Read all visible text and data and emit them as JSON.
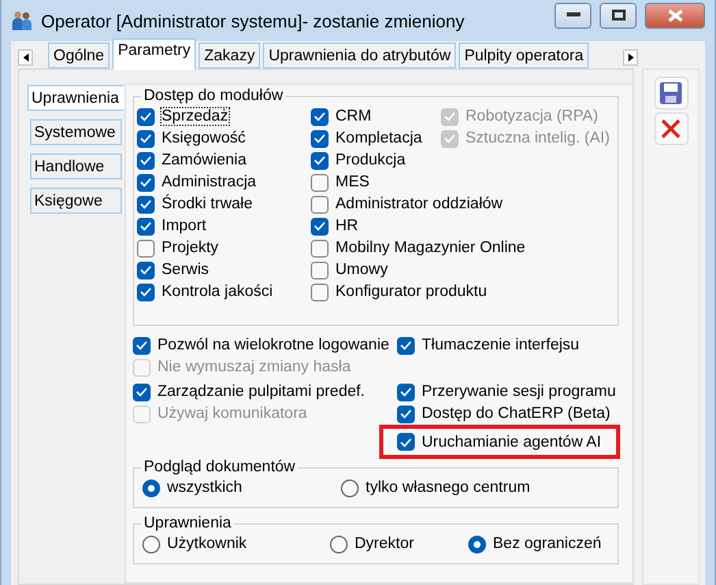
{
  "window": {
    "title": "Operator [Administrator systemu]- zostanie zmieniony"
  },
  "tabs": [
    {
      "label": "Ogólne",
      "selected": false
    },
    {
      "label": "Parametry",
      "selected": true
    },
    {
      "label": "Zakazy",
      "selected": false
    },
    {
      "label": "Uprawnienia do atrybutów",
      "selected": false
    },
    {
      "label": "Pulpity operatora",
      "selected": false
    }
  ],
  "subtabs": [
    {
      "label": "Uprawnienia",
      "selected": true
    },
    {
      "label": "Systemowe",
      "selected": false
    },
    {
      "label": "Handlowe",
      "selected": false
    },
    {
      "label": "Księgowe",
      "selected": false
    }
  ],
  "modules": {
    "title": "Dostęp do modułów",
    "columns": [
      [
        {
          "label": "Sprzedaż",
          "checked": true,
          "disabled": false,
          "focused": true
        },
        {
          "label": "Księgowość",
          "checked": true,
          "disabled": false
        },
        {
          "label": "Zamówienia",
          "checked": true,
          "disabled": false
        },
        {
          "label": "Administracja",
          "checked": true,
          "disabled": false
        },
        {
          "label": "Środki trwałe",
          "checked": true,
          "disabled": false
        },
        {
          "label": "Import",
          "checked": true,
          "disabled": false
        },
        {
          "label": "Projekty",
          "checked": false,
          "disabled": false
        },
        {
          "label": "Serwis",
          "checked": true,
          "disabled": false
        },
        {
          "label": "Kontrola jakości",
          "checked": true,
          "disabled": false
        }
      ],
      [
        {
          "label": "CRM",
          "checked": true,
          "disabled": false
        },
        {
          "label": "Kompletacja",
          "checked": true,
          "disabled": false
        },
        {
          "label": "Produkcja",
          "checked": true,
          "disabled": false
        },
        {
          "label": "MES",
          "checked": false,
          "disabled": false
        },
        {
          "label": "Administrator oddziałów",
          "checked": false,
          "disabled": false
        },
        {
          "label": "HR",
          "checked": true,
          "disabled": false
        },
        {
          "label": "Mobilny Magazynier Online",
          "checked": false,
          "disabled": false
        },
        {
          "label": "Umowy",
          "checked": false,
          "disabled": false
        },
        {
          "label": "Konfigurator produktu",
          "checked": false,
          "disabled": false
        }
      ],
      [
        {
          "label": "Robotyzacja (RPA)",
          "checked": true,
          "disabled": true
        },
        {
          "label": "Sztuczna intelig. (AI)",
          "checked": true,
          "disabled": true
        }
      ]
    ]
  },
  "options": {
    "left": [
      {
        "label": "Pozwól na wielokrotne logowanie",
        "checked": true,
        "disabled": false
      },
      {
        "label": "Nie wymuszaj zmiany hasła",
        "checked": false,
        "disabled": true
      },
      {
        "label": "Zarządzanie pulpitami predef.",
        "checked": true,
        "disabled": false
      },
      {
        "label": "Używaj komunikatora",
        "checked": false,
        "disabled": true
      }
    ],
    "right": [
      {
        "label": "Tłumaczenie interfejsu",
        "checked": true,
        "disabled": false,
        "highlighted": false
      },
      {
        "label": "Przerywanie sesji programu",
        "checked": true,
        "disabled": false,
        "highlighted": false
      },
      {
        "label": "Dostęp do ChatERP (Beta)",
        "checked": true,
        "disabled": false,
        "highlighted": false
      },
      {
        "label": "Uruchamianie agentów AI",
        "checked": true,
        "disabled": false,
        "highlighted": true
      }
    ]
  },
  "radio_groups": [
    {
      "title": "Podgląd dokumentów",
      "options": [
        {
          "label": "wszystkich",
          "selected": true
        },
        {
          "label": "tylko własnego centrum",
          "selected": false
        }
      ]
    },
    {
      "title": "Uprawnienia",
      "options": [
        {
          "label": "Użytkownik",
          "selected": false
        },
        {
          "label": "Dyrektor",
          "selected": false
        },
        {
          "label": "Bez ograniczeń",
          "selected": true
        }
      ]
    }
  ]
}
